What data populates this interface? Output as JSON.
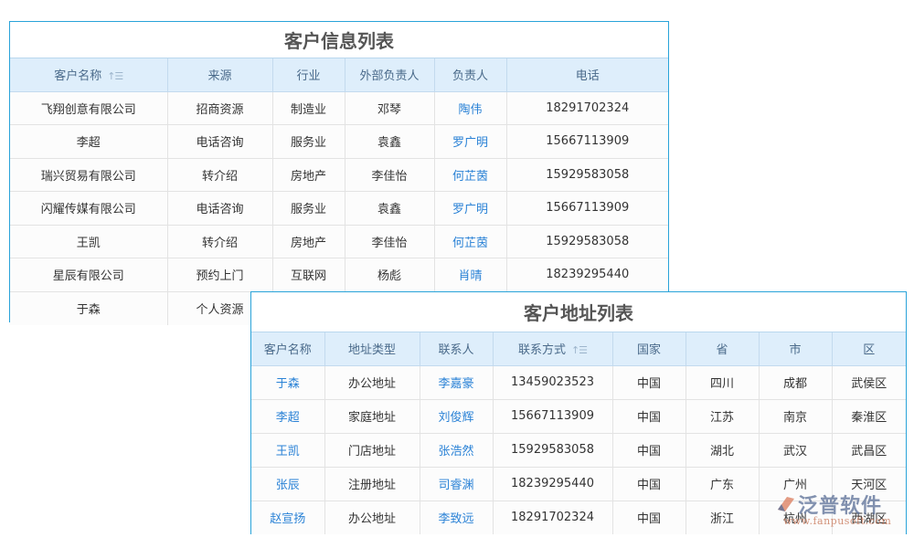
{
  "customer_info": {
    "title": "客户信息列表",
    "columns": [
      "客户名称",
      "来源",
      "行业",
      "外部负责人",
      "负责人",
      "电话"
    ],
    "sort_icon": "sort-icon",
    "rows": [
      [
        "飞翔创意有限公司",
        "招商资源",
        "制造业",
        "邓琴",
        "陶伟",
        "18291702324"
      ],
      [
        "李超",
        "电话咨询",
        "服务业",
        "袁鑫",
        "罗广明",
        "15667113909"
      ],
      [
        "瑞兴贸易有限公司",
        "转介绍",
        "房地产",
        "李佳怡",
        "何芷茵",
        "15929583058"
      ],
      [
        "闪耀传媒有限公司",
        "电话咨询",
        "服务业",
        "袁鑫",
        "罗广明",
        "15667113909"
      ],
      [
        "王凯",
        "转介绍",
        "房地产",
        "李佳怡",
        "何芷茵",
        "15929583058"
      ],
      [
        "星辰有限公司",
        "预约上门",
        "互联网",
        "杨彪",
        "肖晴",
        "18239295440"
      ],
      [
        "于森",
        "个人资源",
        "",
        "",
        "",
        ""
      ]
    ]
  },
  "customer_address": {
    "title": "客户地址列表",
    "columns": [
      "客户名称",
      "地址类型",
      "联系人",
      "联系方式",
      "国家",
      "省",
      "市",
      "区"
    ],
    "sort_icon": "sort-icon",
    "rows": [
      [
        "于森",
        "办公地址",
        "李嘉豪",
        "13459023523",
        "中国",
        "四川",
        "成都",
        "武侯区"
      ],
      [
        "李超",
        "家庭地址",
        "刘俊辉",
        "15667113909",
        "中国",
        "江苏",
        "南京",
        "秦淮区"
      ],
      [
        "王凯",
        "门店地址",
        "张浩然",
        "15929583058",
        "中国",
        "湖北",
        "武汉",
        "武昌区"
      ],
      [
        "张辰",
        "注册地址",
        "司睿渊",
        "18239295440",
        "中国",
        "广东",
        "广州",
        "天河区"
      ],
      [
        "赵宣扬",
        "办公地址",
        "李致远",
        "18291702324",
        "中国",
        "浙江",
        "杭州",
        "西湖区"
      ]
    ]
  },
  "watermark": {
    "brand": "泛普软件",
    "url": "www.fanpusoft.com"
  },
  "colors": {
    "border": "#29a3d9",
    "header_bg": "#deeefb",
    "link": "#2a82d6"
  }
}
